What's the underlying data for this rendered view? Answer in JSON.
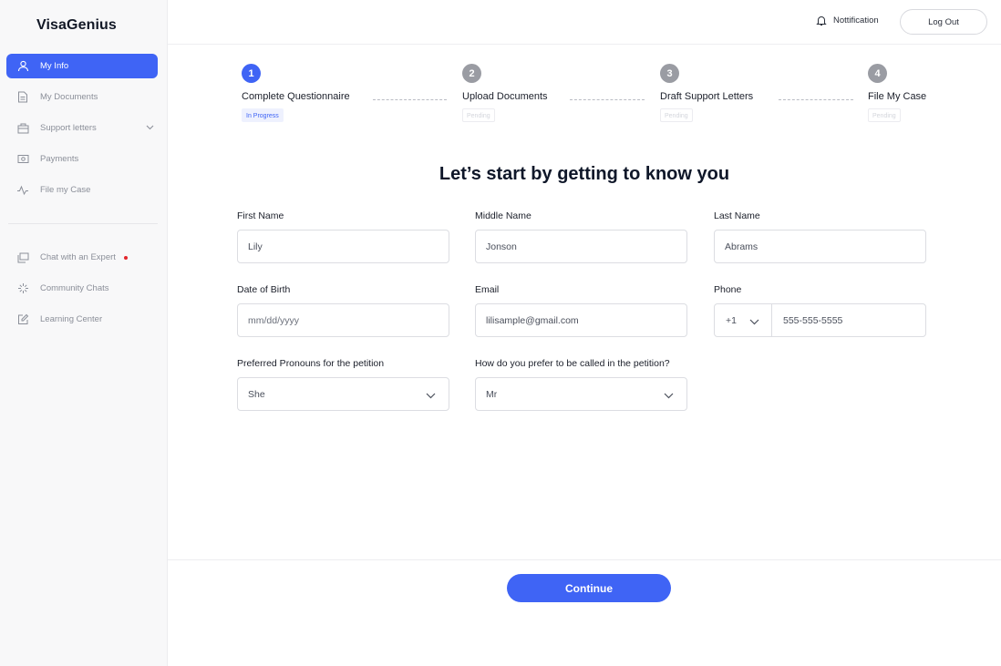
{
  "brand": "VisaGenius",
  "sidebar": {
    "items": [
      {
        "label": "My Info",
        "icon": "user-icon",
        "active": true
      },
      {
        "label": "My Documents",
        "icon": "document-icon"
      },
      {
        "label": "Support letters",
        "icon": "letters-icon"
      },
      {
        "label": "Payments",
        "icon": "payment-icon"
      },
      {
        "label": "File my Case",
        "icon": "activity-icon"
      }
    ],
    "secondary_items": [
      {
        "label": "Chat with an Expert",
        "icon": "chat-icon",
        "has_notification_dot": true
      },
      {
        "label": "Community Chats",
        "icon": "sparkle-icon"
      },
      {
        "label": "Learning Center",
        "icon": "edit-icon"
      }
    ]
  },
  "topbar": {
    "notification_label": "Nottification",
    "logout_label": "Log Out"
  },
  "steps": [
    {
      "number": "1",
      "label": "Complete Questionnaire",
      "status": "In Progress"
    },
    {
      "number": "2",
      "label": "Upload Documents",
      "status": "Pending"
    },
    {
      "number": "3",
      "label": "Draft Support Letters",
      "status": "Pending"
    },
    {
      "number": "4",
      "label": "File My Case",
      "status": "Pending"
    }
  ],
  "form": {
    "heading": "Let’s start by getting to know you",
    "first_name": {
      "label": "First Name",
      "value": "Lily"
    },
    "middle_name": {
      "label": "Middle Name",
      "value": "Jonson"
    },
    "last_name": {
      "label": "Last Name",
      "value": "Abrams"
    },
    "dob": {
      "label": "Date of Birth",
      "placeholder": "mm/dd/yyyy"
    },
    "email": {
      "label": "Email",
      "value": "lilisample@gmail.com"
    },
    "phone": {
      "label": "Phone",
      "country_code": "+1",
      "value": "555-555-5555"
    },
    "pronouns": {
      "label": "Preferred Pronouns for the petition",
      "value": "She"
    },
    "called": {
      "label": "How do you prefer to be called in the petition?",
      "value": "Mr"
    }
  },
  "continue_label": "Continue",
  "colors": {
    "accent": "#3f64f5",
    "step_inactive": "#9a9ca3",
    "notification_dot": "#e3262c"
  }
}
